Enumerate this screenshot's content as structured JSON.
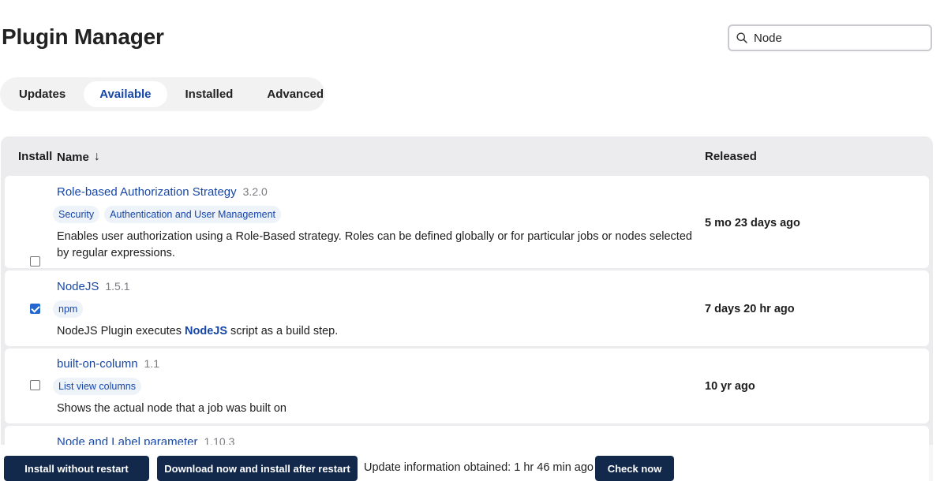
{
  "header": {
    "title": "Plugin Manager",
    "search_value": "Node"
  },
  "tabs": [
    {
      "label": "Updates",
      "active": false
    },
    {
      "label": "Available",
      "active": true
    },
    {
      "label": "Installed",
      "active": false
    },
    {
      "label": "Advanced",
      "active": false
    }
  ],
  "table": {
    "columns": {
      "install": "Install",
      "name": "Name",
      "sort_indicator": "↓",
      "released": "Released"
    },
    "rows": [
      {
        "name": "Role-based Authorization Strategy",
        "version": "3.2.0",
        "tags": [
          "Security",
          "Authentication and User Management"
        ],
        "description": "Enables user authorization using a Role-Based strategy. Roles can be defined globally or for particular jobs or nodes selected by regular expressions.",
        "released": "5 mo 23 days ago",
        "checked": false
      },
      {
        "name": "NodeJS",
        "version": "1.5.1",
        "tags": [
          "npm"
        ],
        "description_before": "NodeJS Plugin executes ",
        "description_link": "NodeJS",
        "description_after": " script as a build step.",
        "released": "7 days 20 hr ago",
        "checked": true
      },
      {
        "name": "built-on-column",
        "version": "1.1",
        "tags": [
          "List view columns"
        ],
        "description": "Shows the actual node that a job was built on",
        "released": "10 yr ago",
        "checked": false
      },
      {
        "name": "Node and Label parameter",
        "version": "1.10.3"
      }
    ]
  },
  "footer": {
    "install_without_restart": "Install without restart",
    "download_install_after_restart": "Download now and install after restart",
    "update_info": "Update information obtained: 1 hr 46 min ago",
    "check_now": "Check now"
  },
  "colors": {
    "link": "#1647a8",
    "primary_button": "#13294b",
    "checkbox_checked": "#2467cf"
  },
  "icons": {
    "search": "search-icon"
  }
}
